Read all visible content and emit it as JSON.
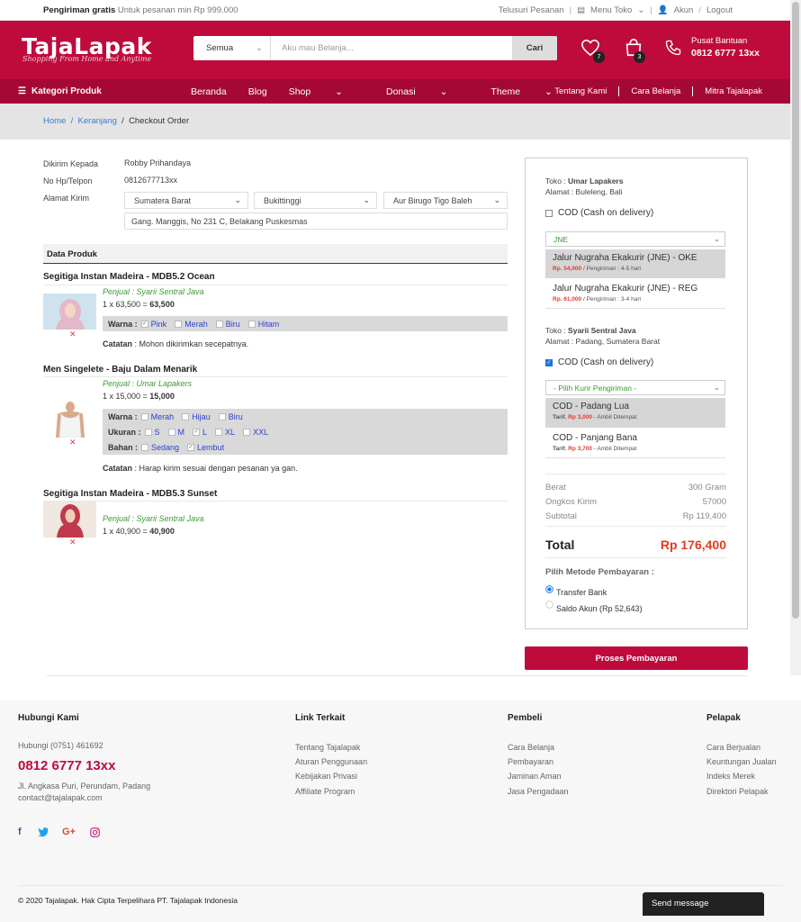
{
  "topbar": {
    "ship_bold": "Pengiriman gratis",
    "ship_text": "Untuk pesanan min Rp 999.000",
    "track": "Telusuri Pesanan",
    "store_menu": "Menu Toko",
    "account": "Akun",
    "logout": "Logout"
  },
  "header": {
    "logo": "TajaLapak",
    "tagline": "Shopping From Home and Anytime",
    "search_category": "Semua",
    "search_placeholder": "Aku mau Belanja...",
    "search_button": "Cari",
    "wishlist_count": "7",
    "cart_count": "3",
    "help_title": "Pusat Bantuan",
    "help_phone": "0812 6777 13xx"
  },
  "nav": {
    "categories": "Kategori Produk",
    "items": [
      "Beranda",
      "Blog",
      "Shop",
      "Donasi",
      "Theme"
    ],
    "right": [
      "Tentang Kami",
      "Cara Belanja",
      "Mitra Tajalapak"
    ]
  },
  "breadcrumb": {
    "home": "Home",
    "cart": "Keranjang",
    "current": "Checkout Order"
  },
  "shipping": {
    "to_label": "Dikirim Kepada",
    "to_value": "Robby Prihandaya",
    "phone_label": "No Hp/Telpon",
    "phone_value": "0812677713xx",
    "address_label": "Alamat Kirim",
    "province": "Sumatera Barat",
    "city": "Bukittinggi",
    "district": "Aur Birugo Tigo Baleh",
    "street": "Gang. Manggis, No 231 C, Belakang Puskesmas"
  },
  "products_header": "Data Produk",
  "products": [
    {
      "name": "Segitiga Instan Madeira - MDB5.2 Ocean",
      "seller": "Penjual : Syarii Sentral Java",
      "qty_text": "1 x 63,500 = ",
      "total": "63,500",
      "color_label": "Warna :",
      "colors": [
        "Pink",
        "Merah",
        "Biru",
        "Hitam"
      ],
      "note_label": "Catatan",
      "note": ": Mohon dikirimkan secepatnya."
    },
    {
      "name": "Men Singelete - Baju Dalam Menarik",
      "seller": "Penjual : Umar Lapakers",
      "qty_text": "1 x 15,000 = ",
      "total": "15,000",
      "color_label": "Warna :",
      "colors": [
        "Merah",
        "Hijau",
        "Biru"
      ],
      "size_label": "Ukuran :",
      "sizes": [
        "S",
        "M",
        "L",
        "XL",
        "XXL"
      ],
      "material_label": "Bahan :",
      "materials": [
        "Sedang",
        "Lembut"
      ],
      "note_label": "Catatan",
      "note": ": Harap kirim sesuai dengan pesanan ya gan."
    },
    {
      "name": "Segitiga Instan Madeira - MDB5.3 Sunset",
      "seller": "Penjual : Syarii Sentral Java",
      "qty_text": "1 x 40,900 = ",
      "total": "40,900"
    }
  ],
  "panel": {
    "store1": "Umar Lapakers",
    "store1_addr": "Buleleng, Bali",
    "store_label": "Toko : ",
    "addr_label": "Alamat : ",
    "cod_label": "COD (Cash on delivery)",
    "courier1": "JNE",
    "options1": [
      {
        "name": "Jalur Nugraha Ekakurir (JNE) - OKE",
        "price": "Rp. 54,000",
        "detail": "/ Pengiriman : 4-5 hari"
      },
      {
        "name": "Jalur Nugraha Ekakurir (JNE) - REG",
        "price": "Rp. 61,000",
        "detail": "/ Pengiriman : 3-4 hari"
      }
    ],
    "store2": "Syarii Sentral Java",
    "store2_addr": "Padang, Sumatera Barat",
    "courier2": "- Pilih Kurir Pengiriman -",
    "options2": [
      {
        "name": "COD - Padang Lua",
        "tarif": "Tarif.",
        "price": "Rp 3,000",
        "detail": "- Ambil Ditempat"
      },
      {
        "name": "COD - Panjang Bana",
        "tarif": "Tarif.",
        "price": "Rp 3,700",
        "detail": "- Ambil Ditempat"
      }
    ],
    "weight_label": "Berat",
    "weight": "300 Gram",
    "shipping_label": "Ongkos Kirim",
    "shipping": "57000",
    "subtotal_label": "Subtotal",
    "subtotal": "Rp 119,400",
    "total_label": "Total",
    "total": "Rp 176,400",
    "payment_label": "Pilih Metode Pembayaran :",
    "pay_transfer": "Transfer Bank",
    "pay_saldo": "Saldo Akun (Rp 52,643)",
    "process_button": "Proses Pembayaran"
  },
  "footer": {
    "contact_title": "Hubungi Kami",
    "contact_phone_small": "Hubungi (0751) 461692",
    "contact_phone_big": "0812 6777 13xx",
    "address": "Jl. Angkasa Puri, Perundam, Padang",
    "email": "contact@tajalapak.com",
    "links_title": "Link Terkait",
    "links": [
      "Tentang Tajalapak",
      "Aturan Penggunaan",
      "Kebijakan Privasi",
      "Affiliate Program"
    ],
    "buyer_title": "Pembeli",
    "buyer": [
      "Cara Belanja",
      "Pembayaran",
      "Jaminan Aman",
      "Jasa Pengadaan"
    ],
    "seller_title": "Pelapak",
    "seller": [
      "Cara Berjualan",
      "Keuntungan Jualan",
      "Indeks Merek",
      "Direktori Pelapak"
    ],
    "copyright": "© 2020 Tajalapak. Hak Cipta Terpelihara PT. Tajalapak Indonesia",
    "send_message": "Send message"
  }
}
